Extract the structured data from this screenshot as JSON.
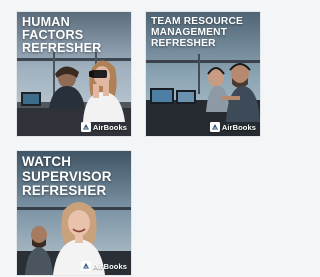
{
  "courses": [
    {
      "title_lines": [
        "HUMAN",
        "FACTORS",
        "REFRESHER"
      ],
      "brand": "AirBooks",
      "brand_icon": "airbooks-logo-icon",
      "image": "two people in airport control tower with binoculars"
    },
    {
      "title_lines": [
        "TEAM RESOURCE",
        "MANAGEMENT",
        "REFRESHER"
      ],
      "brand": "AirBooks",
      "brand_icon": "airbooks-logo-icon",
      "image": "controllers working at tower consoles"
    },
    {
      "title_lines": [
        "WATCH",
        "SUPERVISOR",
        "REFRESHER"
      ],
      "brand": "AirBooks",
      "brand_icon": "airbooks-logo-icon",
      "image": "smiling supervisor in control tower"
    }
  ],
  "colors": {
    "page_background": "#f4f5f7",
    "title_text": "#ffffff",
    "brand_text": "#ffffff"
  }
}
